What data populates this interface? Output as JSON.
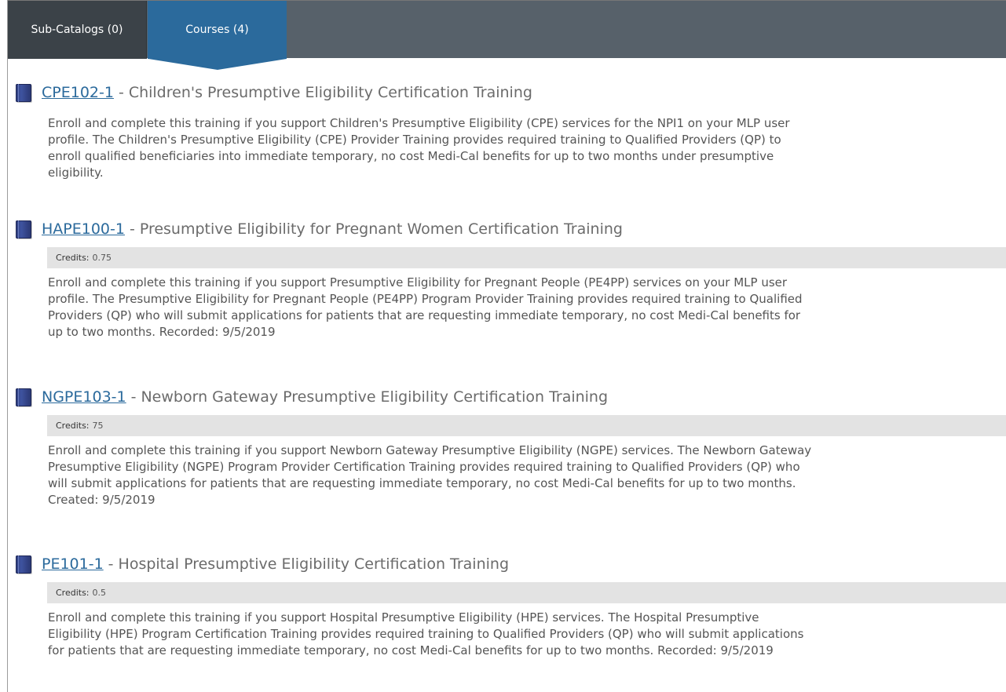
{
  "tabs": [
    {
      "label": "Sub-Catalogs (0)",
      "active": false
    },
    {
      "label": "Courses (4)",
      "active": true
    }
  ],
  "colors": {
    "tabbar": "#57616a",
    "active_tab": "#2b6a9c",
    "link": "#2b6a9c",
    "credits_bar": "#e3e3e3"
  },
  "course_icon": "book-icon",
  "separator": "-",
  "credits_label": "Credits:",
  "courses": [
    {
      "code": "CPE102-1",
      "title": "Children's Presumptive Eligibility Certification Training",
      "credits": null,
      "description_lines": [
        "Enroll and complete this training if you support Children's Presumptive Eligibility (CPE) services for the NPI1 on your MLP user",
        "profile. The Children's Presumptive Eligibility (CPE) Provider Training provides required training to Qualified Providers (QP) to",
        "enroll qualified beneficiaries into immediate temporary, no cost Medi-Cal benefits for up to two months under presumptive",
        "eligibility."
      ]
    },
    {
      "code": "HAPE100-1",
      "title": "Presumptive Eligibility for Pregnant Women Certification Training",
      "credits": "0.75",
      "description_lines": [
        "Enroll and complete this training if you support Presumptive Eligibility for Pregnant People (PE4PP) services on your MLP user",
        "profile. The Presumptive Eligibility for Pregnant People (PE4PP) Program Provider Training provides required training to Qualified",
        "Providers (QP) who will submit applications for patients that are requesting immediate temporary, no cost Medi-Cal benefits for",
        "up to two months. Recorded: 9/5/2019"
      ]
    },
    {
      "code": "NGPE103-1",
      "title": "Newborn Gateway Presumptive Eligibility Certification Training",
      "credits": "75",
      "description_lines": [
        "Enroll and complete this training if you support Newborn Gateway Presumptive Eligibility (NGPE) services. The Newborn Gateway",
        "Presumptive Eligibility (NGPE) Program Provider Certification Training provides required training to Qualified Providers (QP) who",
        "will submit applications for patients that are requesting immediate temporary, no cost Medi-Cal benefits for up to two months.",
        "Created: 9/5/2019"
      ]
    },
    {
      "code": "PE101-1",
      "title": "Hospital Presumptive Eligibility Certification Training",
      "credits": "0.5",
      "description_lines": [
        "Enroll and complete this training if you support Hospital Presumptive Eligibility (HPE) services. The Hospital Presumptive",
        "Eligibility (HPE) Program Certification Training provides required training to Qualified Providers (QP) who will submit applications",
        "for patients that are requesting immediate temporary, no cost Medi-Cal benefits for up to two months. Recorded: 9/5/2019"
      ]
    }
  ]
}
